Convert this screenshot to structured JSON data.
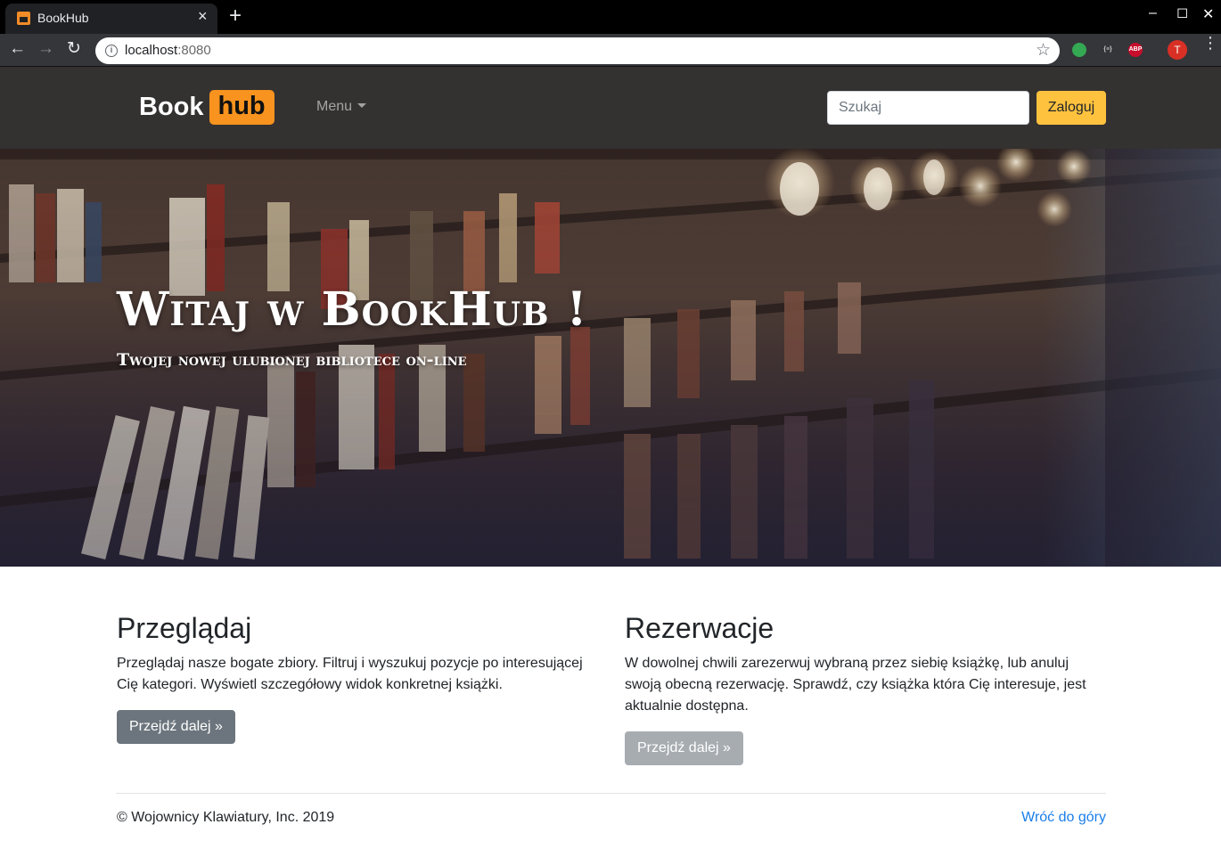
{
  "browser": {
    "tab_title": "BookHub",
    "tab_close": "×",
    "new_tab": "+",
    "url_host": "localhost",
    "url_port": ":8080",
    "profile_initial": "T",
    "extensions": [
      {
        "name": "extension-green-icon",
        "color": "#34a853"
      },
      {
        "name": "extension-json-icon",
        "label": "{≡}"
      },
      {
        "name": "adblock-icon",
        "label": "ABP",
        "color": "#c70d2c"
      }
    ]
  },
  "navbar": {
    "brand_book": "Book",
    "brand_hub": "hub",
    "menu_label": "Menu",
    "search_placeholder": "Szukaj",
    "login_label": "Zaloguj"
  },
  "hero": {
    "title": "Witaj w BookHub !",
    "subtitle": "Twojej nowej ulubionej bibliotece on-line"
  },
  "sections": [
    {
      "heading": "Przeglądaj",
      "text": "Przeglądaj nasze bogate zbiory. Filtruj i wyszukuj pozycje po interesującej Cię kategori. Wyświetl szczegółowy widok konkretnej książki.",
      "button": "Przejdź dalej »"
    },
    {
      "heading": "Rezerwacje",
      "text": "W dowolnej chwili zarezerwuj wybraną przez siebię książkę, lub anuluj swoją obecną rezerwację. Sprawdź, czy książka która Cię interesuje, jest aktualnie dostępna.",
      "button": "Przejdź dalej »"
    }
  ],
  "footer": {
    "copyright": "© Wojownicy Klawiatury, Inc. 2019",
    "back_to_top": "Wróć do góry"
  },
  "colors": {
    "navbar_bg": "#343131",
    "brand_accent": "#f7931e",
    "login_button": "#ffc23e",
    "link": "#1a7ee8"
  }
}
